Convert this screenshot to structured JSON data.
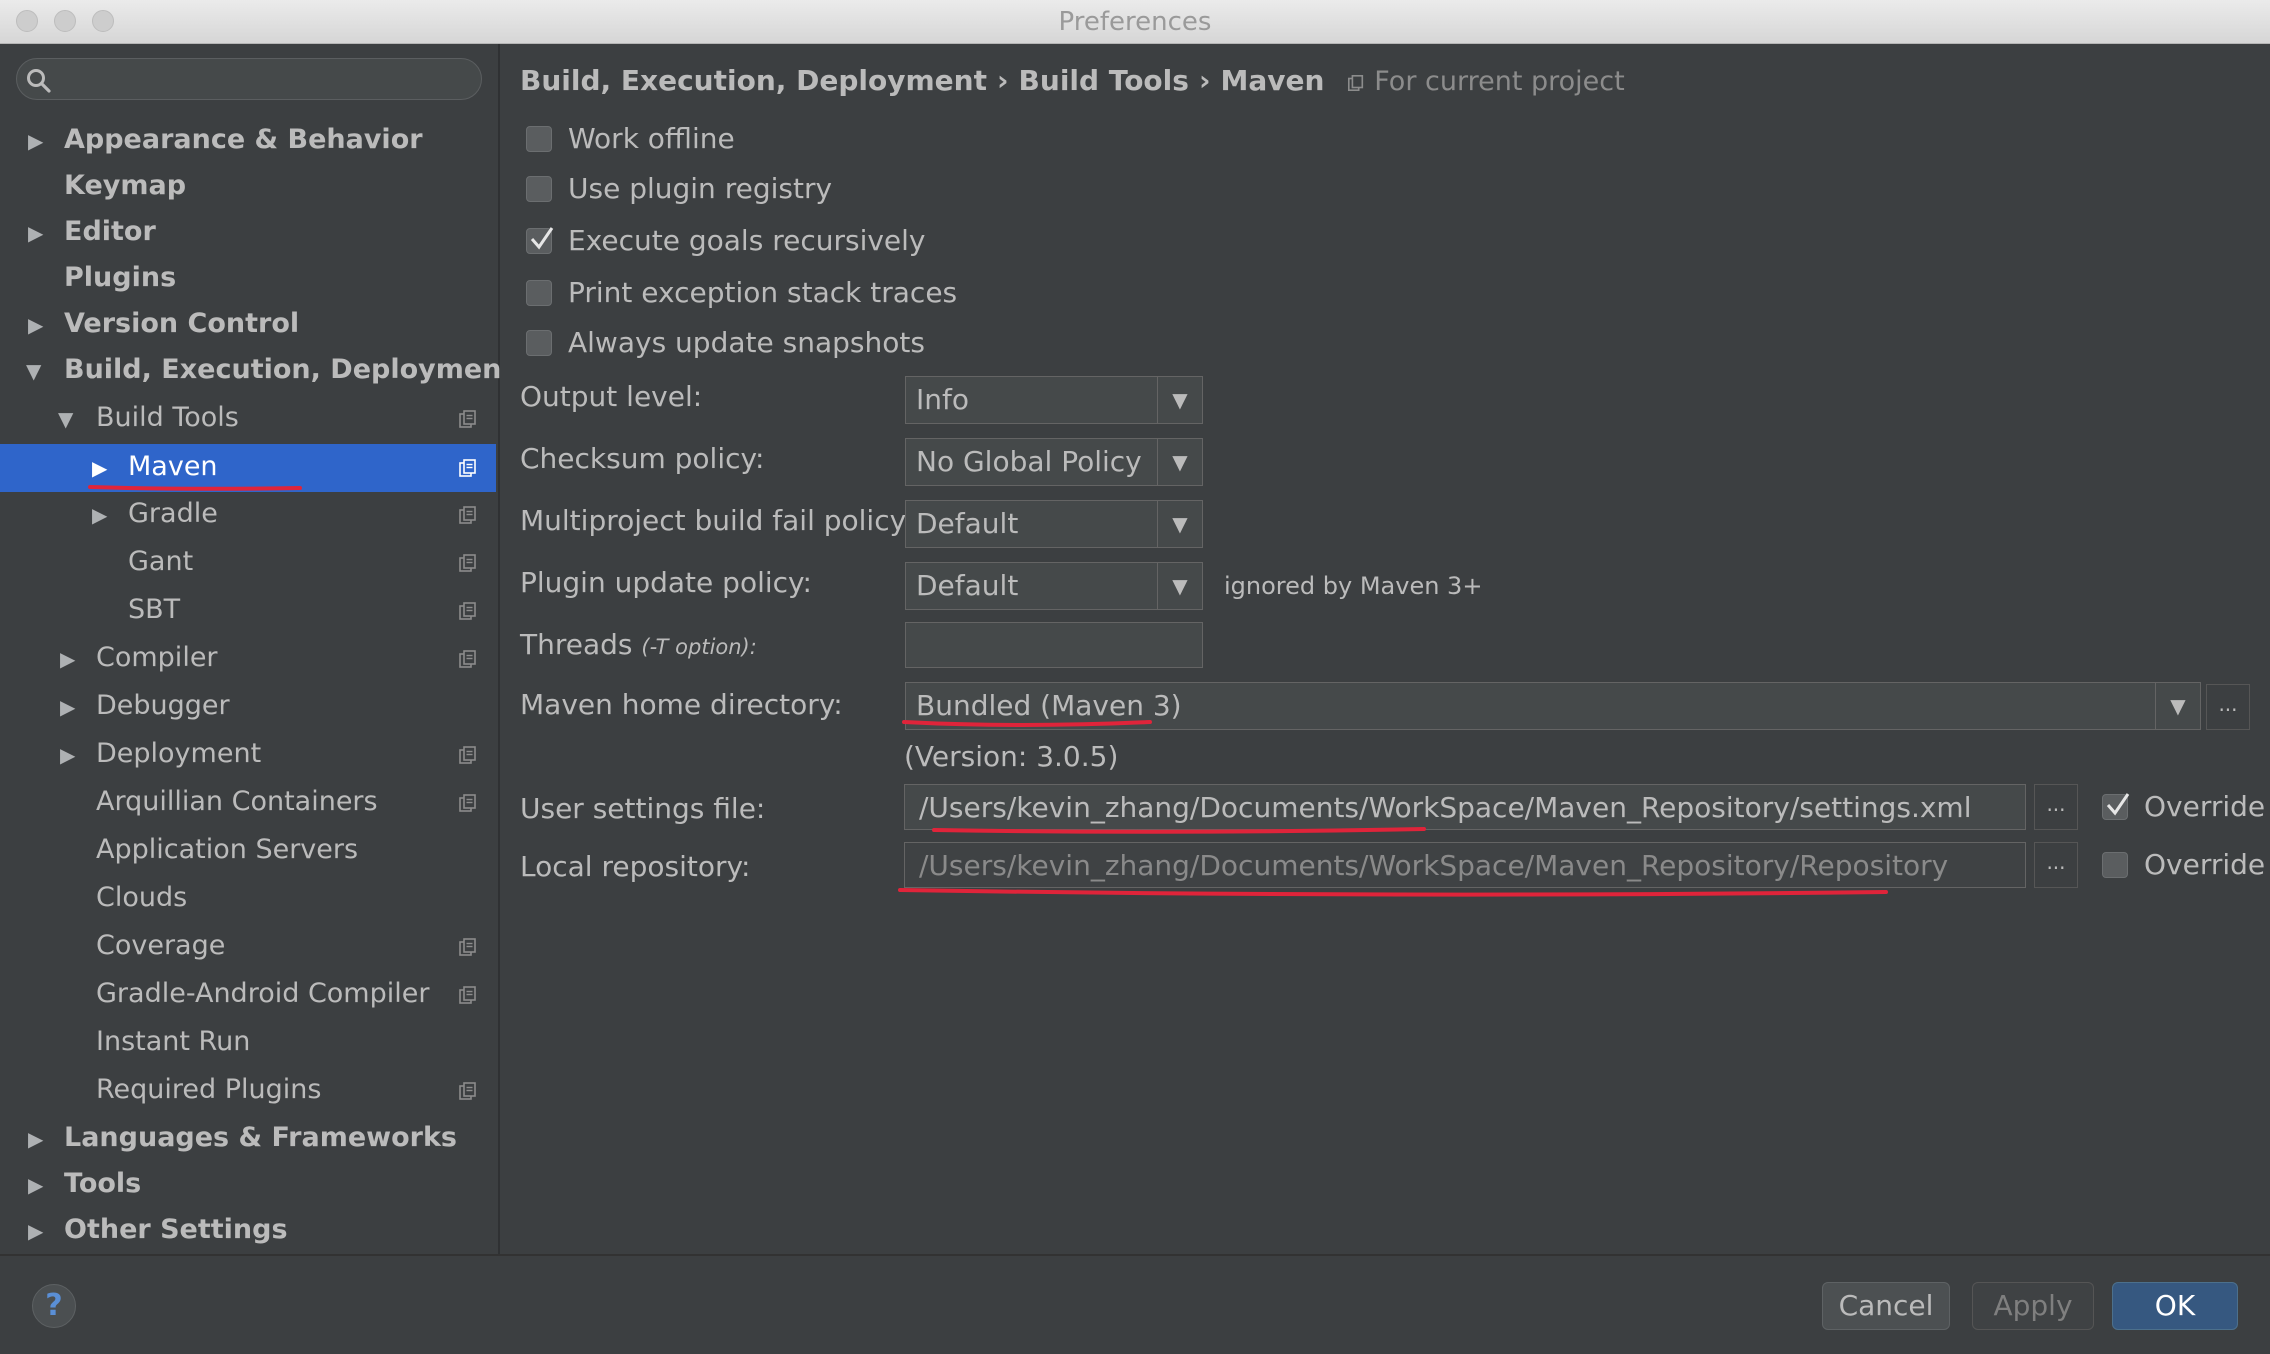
{
  "window": {
    "title": "Preferences"
  },
  "search": {
    "placeholder": ""
  },
  "sidebar": {
    "items": [
      {
        "label": "Appearance & Behavior"
      },
      {
        "label": "Keymap"
      },
      {
        "label": "Editor"
      },
      {
        "label": "Plugins"
      },
      {
        "label": "Version Control"
      },
      {
        "label": "Build, Execution, Deployment"
      },
      {
        "label": "Build Tools"
      },
      {
        "label": "Maven"
      },
      {
        "label": "Gradle"
      },
      {
        "label": "Gant"
      },
      {
        "label": "SBT"
      },
      {
        "label": "Compiler"
      },
      {
        "label": "Debugger"
      },
      {
        "label": "Deployment"
      },
      {
        "label": "Arquillian Containers"
      },
      {
        "label": "Application Servers"
      },
      {
        "label": "Clouds"
      },
      {
        "label": "Coverage"
      },
      {
        "label": "Gradle-Android Compiler"
      },
      {
        "label": "Instant Run"
      },
      {
        "label": "Required Plugins"
      },
      {
        "label": "Languages & Frameworks"
      },
      {
        "label": "Tools"
      },
      {
        "label": "Other Settings"
      }
    ]
  },
  "breadcrumb": {
    "parts": [
      "Build, Execution, Deployment",
      "Build Tools",
      "Maven"
    ],
    "separator": "›",
    "scope": "For current project"
  },
  "options": {
    "work_offline": {
      "label": "Work offline",
      "checked": false
    },
    "use_plugin_registry": {
      "label": "Use plugin registry",
      "checked": false
    },
    "execute_goals_recursively": {
      "label": "Execute goals recursively",
      "checked": true
    },
    "print_exception_stack_traces": {
      "label": "Print exception stack traces",
      "checked": false
    },
    "always_update_snapshots": {
      "label": "Always update snapshots",
      "checked": false
    }
  },
  "settings": {
    "output_level": {
      "label": "Output level:",
      "value": "Info"
    },
    "checksum_policy": {
      "label": "Checksum policy:",
      "value": "No Global Policy"
    },
    "multiproject_fail_policy": {
      "label": "Multiproject build fail policy:",
      "value": "Default"
    },
    "plugin_update_policy": {
      "label": "Plugin update policy:",
      "value": "Default",
      "note": "ignored by Maven 3+"
    },
    "threads": {
      "label": "Threads",
      "hint": "(-T option):",
      "value": ""
    },
    "maven_home": {
      "label": "Maven home directory:",
      "value": "Bundled (Maven 3)",
      "version": "(Version: 3.0.5)"
    },
    "user_settings": {
      "label": "User settings file:",
      "value": "/Users/kevin_zhang/Documents/WorkSpace/Maven_Repository/settings.xml",
      "override_label": "Override",
      "override_checked": true
    },
    "local_repository": {
      "label": "Local repository:",
      "value": "/Users/kevin_zhang/Documents/WorkSpace/Maven_Repository/Repository",
      "override_label": "Override",
      "override_checked": false
    }
  },
  "buttons": {
    "dots": "...",
    "help": "?",
    "cancel": "Cancel",
    "apply": "Apply",
    "ok": "OK",
    "dropdown_arrow": "▼",
    "arrow_right": "▶",
    "arrow_down": "▼"
  },
  "colors": {
    "selection": "#2f65ca",
    "annotation_red": "#e0243a",
    "ok_button": "#365880"
  }
}
